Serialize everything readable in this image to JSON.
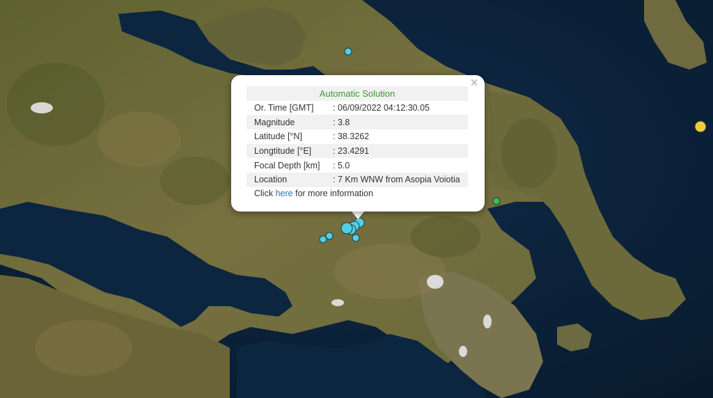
{
  "popup": {
    "heading": "Automatic Solution",
    "close_label": "×",
    "rows": [
      {
        "key": "Or. Time [GMT]",
        "value": ": 06/09/2022 04:12:30.05"
      },
      {
        "key": "Magnitude",
        "value": ": 3.8"
      },
      {
        "key": "Latitude [°N]",
        "value": ": 38.3262"
      },
      {
        "key": "Longtitude [°E]",
        "value": ": 23.4291"
      },
      {
        "key": "Focal Depth [km]",
        "value": ": 5.0"
      },
      {
        "key": "Location",
        "value": ": 7 Km WNW from Asopia Voiotia"
      }
    ],
    "more_prefix": "Click",
    "more_link": "here",
    "more_suffix": "for more information"
  },
  "markers": {
    "cyan_color": "#53cfe4",
    "yellow_color": "#f2cc3a",
    "green_color": "#3cbc4c"
  },
  "map": {
    "sea_color": "#0b2138",
    "land_color": "#6e6a3b"
  }
}
